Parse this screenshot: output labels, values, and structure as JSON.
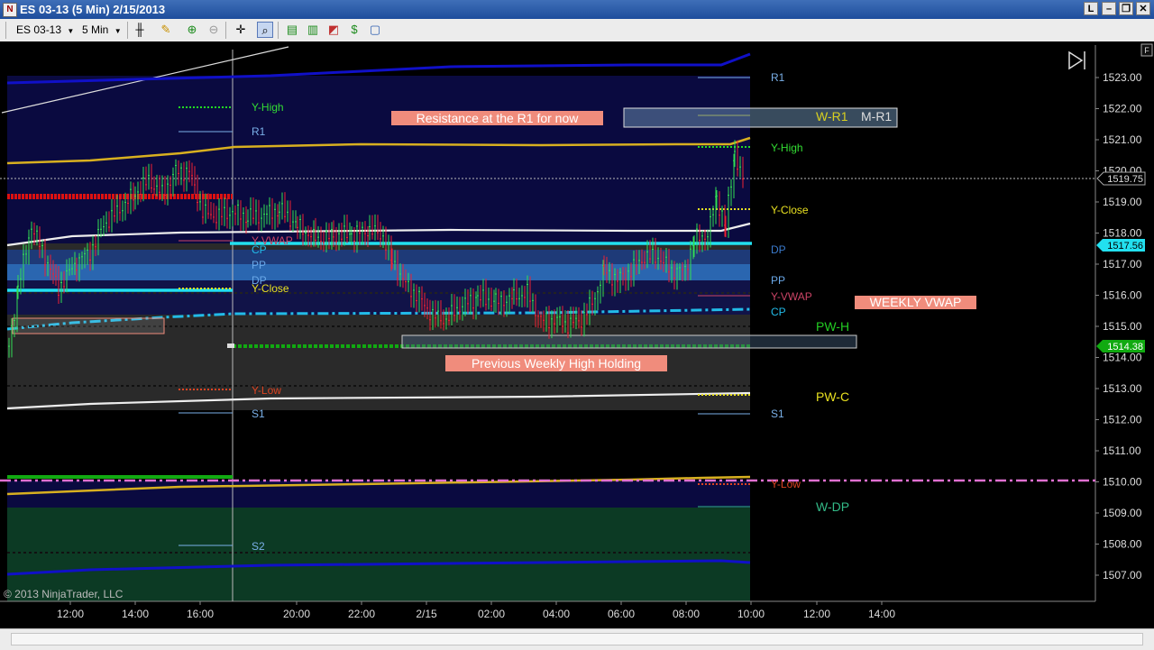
{
  "window": {
    "title": "ES 03-13 (5 Min)  2/15/2013",
    "buttons": {
      "restore": "L",
      "minimize": "–",
      "maximize": "❐",
      "close": "✕"
    }
  },
  "toolbar": {
    "instrument": "ES 03-13",
    "interval": "5 Min"
  },
  "chart": {
    "copyright": "© 2013 NinjaTrader, LLC",
    "f_button": "F",
    "right_scale": {
      "ticks": [
        "1523.00",
        "1522.00",
        "1521.00",
        "1520.00",
        "1519.00",
        "1518.00",
        "1517.00",
        "1516.00",
        "1515.00",
        "1514.00",
        "1513.00",
        "1512.00",
        "1511.00",
        "1510.00",
        "1509.00",
        "1508.00",
        "1507.00"
      ],
      "cursor_price": "1519.75",
      "marker_cyan": "1517.56",
      "marker_green": "1514.38"
    },
    "time_axis": [
      "12:00",
      "14:00",
      "16:00",
      "20:00",
      "22:00",
      "2/15",
      "02:00",
      "04:00",
      "06:00",
      "08:00",
      "10:00",
      "12:00",
      "14:00"
    ],
    "pivot_labels_left": {
      "y_high": "Y-High",
      "r1": "R1",
      "y_vwap": "Y-VWAP",
      "cp": "CP",
      "pp": "PP",
      "dp": "DP",
      "y_close": "Y-Close",
      "y_low": "Y-Low",
      "s1": "S1",
      "s2": "S2"
    },
    "pivot_labels_right": {
      "r1": "R1",
      "y_high": "Y-High",
      "y_close": "Y-Close",
      "dp": "DP",
      "pp": "PP",
      "y_vwap": "Y-VWAP",
      "cp": "CP",
      "s1": "S1",
      "y_low": "Y-Low"
    },
    "weekly_labels": {
      "w_r1": "W-R1",
      "m_r1": "M-R1",
      "pw_h": "PW-H",
      "pw_c": "PW-C",
      "w_dp": "W-DP"
    },
    "annotations": {
      "resistance": "Resistance at the R1 for now",
      "weekly_vwap": "WEEKLY VWAP",
      "prev_weekly_high": "Previous Weekly High Holding"
    },
    "colors": {
      "background": "#000000",
      "annotation_box": "#f08c7c",
      "vwap_cyan": "#22e0f0",
      "pivot_red": "#dd1111",
      "pw_high_green": "#11aa11",
      "gold": "#d8b020",
      "pink_dashdot": "#e070d0"
    }
  }
}
